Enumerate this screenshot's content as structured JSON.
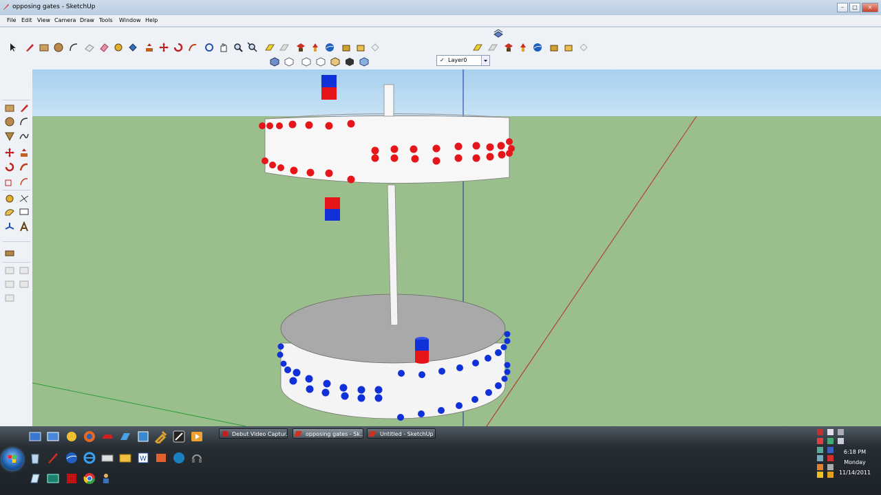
{
  "window": {
    "title": "opposing gates - SketchUp",
    "controls": {
      "minimize": "–",
      "maximize": "□",
      "close": "×"
    }
  },
  "menu": [
    "File",
    "Edit",
    "View",
    "Camera",
    "Draw",
    "Tools",
    "Window",
    "Help"
  ],
  "layer": {
    "check": "✓",
    "name": "Layer0"
  },
  "taskbar": {
    "tasks": [
      {
        "label": "Debut Video Captur...",
        "active": false
      },
      {
        "label": "opposing gates - Sk...",
        "active": true
      },
      {
        "label": "Untitled - SketchUp",
        "active": false
      }
    ],
    "clock": {
      "time": "6:18 PM",
      "day": "Monday",
      "date": "11/14/2011"
    }
  },
  "colors": {
    "sky": "#a9d2ee",
    "ground": "#9bbf8c",
    "magnet_red": "#e5151a",
    "magnet_blue": "#1030d8",
    "axis_red": "#b82a1e",
    "axis_green": "#2c9a3a",
    "axis_blue": "#1a2aa0"
  }
}
